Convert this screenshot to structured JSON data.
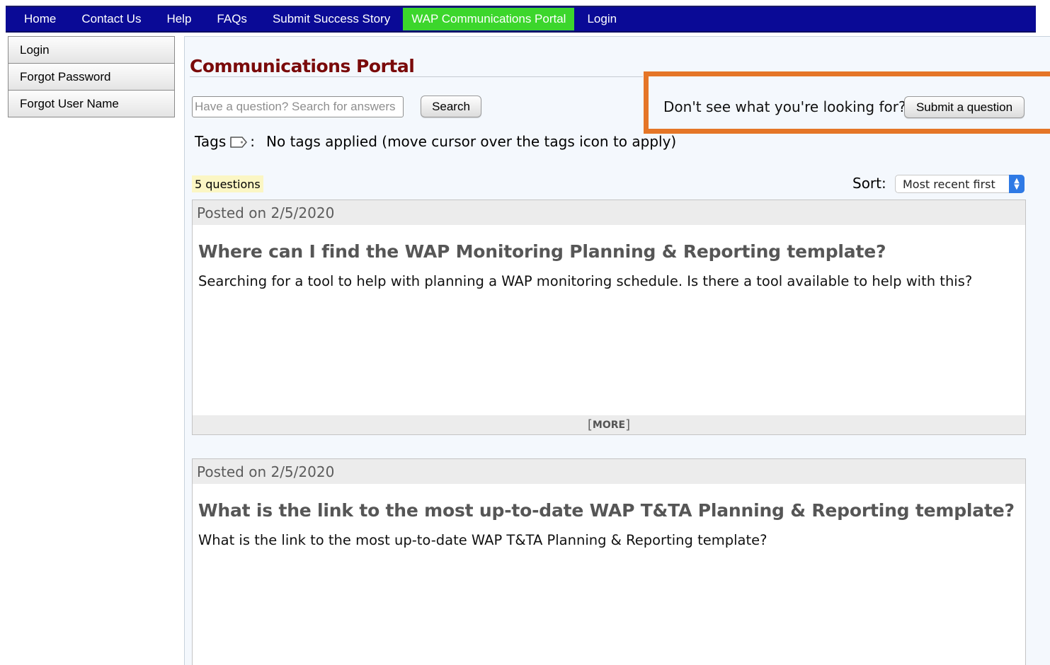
{
  "nav": {
    "items": [
      {
        "label": "Home"
      },
      {
        "label": "Contact Us"
      },
      {
        "label": "Help"
      },
      {
        "label": "FAQs"
      },
      {
        "label": "Submit Success Story"
      },
      {
        "label": "WAP Communications Portal",
        "active": true
      },
      {
        "label": "Login"
      }
    ],
    "bg_color": "#0a0a96",
    "active_color": "#3cd62c"
  },
  "sidebar": {
    "items": [
      {
        "label": "Login"
      },
      {
        "label": "Forgot Password"
      },
      {
        "label": "Forgot User Name"
      }
    ]
  },
  "main": {
    "title": "Communications Portal",
    "search": {
      "placeholder": "Have a question? Search for answers",
      "button": "Search"
    },
    "callout": {
      "text": "Don't see what you're looking for?",
      "button": "Submit a question",
      "highlight_color": "#e57627"
    },
    "tags": {
      "label": "Tags",
      "colon": ":",
      "text": "No tags applied (move cursor over the tags icon to apply)",
      "icon": "tag-icon"
    },
    "count": "5 questions",
    "sort": {
      "label": "Sort:",
      "value": "Most recent first"
    },
    "questions": [
      {
        "posted": "Posted on 2/5/2020",
        "title": "Where can I find the WAP Monitoring Planning & Reporting template?",
        "body": "Searching for a tool to help with planning a WAP monitoring schedule. Is there a tool available to help with this?",
        "more": "MORE"
      },
      {
        "posted": "Posted on 2/5/2020",
        "title": "What is the link to the most up-to-date WAP T&TA Planning & Reporting template?",
        "body": "What is the link to the most up-to-date WAP T&TA Planning & Reporting template?"
      }
    ]
  }
}
